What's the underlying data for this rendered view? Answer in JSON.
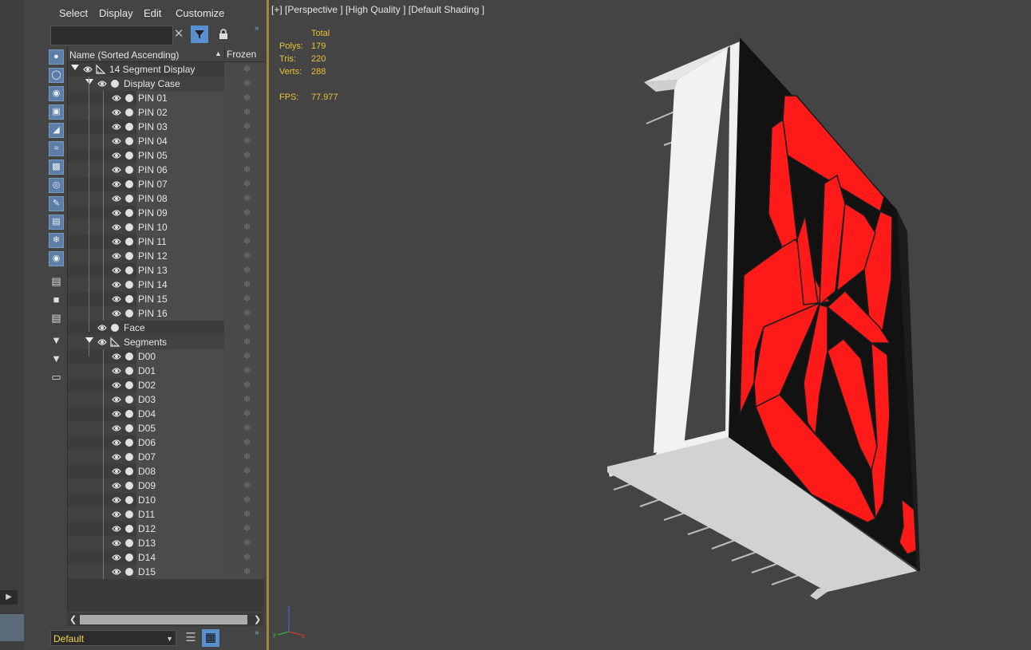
{
  "menu": {
    "select": "Select",
    "display": "Display",
    "edit": "Edit",
    "customize": "Customize"
  },
  "search": {
    "value": "",
    "placeholder": ""
  },
  "tree": {
    "col_name": "Name (Sorted Ascending)",
    "col_frozen": "Frozen",
    "rows": [
      {
        "label": "14 Segment Display",
        "depth": 0,
        "expander": true,
        "kind": "helper"
      },
      {
        "label": "Display Case",
        "depth": 1,
        "expander": true,
        "kind": "geo"
      },
      {
        "label": "PIN 01",
        "depth": 2,
        "expander": false,
        "kind": "geo"
      },
      {
        "label": "PIN 02",
        "depth": 2,
        "expander": false,
        "kind": "geo"
      },
      {
        "label": "PIN 03",
        "depth": 2,
        "expander": false,
        "kind": "geo"
      },
      {
        "label": "PIN 04",
        "depth": 2,
        "expander": false,
        "kind": "geo"
      },
      {
        "label": "PIN 05",
        "depth": 2,
        "expander": false,
        "kind": "geo"
      },
      {
        "label": "PIN 06",
        "depth": 2,
        "expander": false,
        "kind": "geo"
      },
      {
        "label": "PIN 07",
        "depth": 2,
        "expander": false,
        "kind": "geo"
      },
      {
        "label": "PIN 08",
        "depth": 2,
        "expander": false,
        "kind": "geo"
      },
      {
        "label": "PIN 09",
        "depth": 2,
        "expander": false,
        "kind": "geo"
      },
      {
        "label": "PIN 10",
        "depth": 2,
        "expander": false,
        "kind": "geo"
      },
      {
        "label": "PIN 11",
        "depth": 2,
        "expander": false,
        "kind": "geo"
      },
      {
        "label": "PIN 12",
        "depth": 2,
        "expander": false,
        "kind": "geo"
      },
      {
        "label": "PIN 13",
        "depth": 2,
        "expander": false,
        "kind": "geo"
      },
      {
        "label": "PIN 14",
        "depth": 2,
        "expander": false,
        "kind": "geo"
      },
      {
        "label": "PIN 15",
        "depth": 2,
        "expander": false,
        "kind": "geo"
      },
      {
        "label": "PIN 16",
        "depth": 2,
        "expander": false,
        "kind": "geo"
      },
      {
        "label": "Face",
        "depth": 1,
        "expander": false,
        "kind": "geo"
      },
      {
        "label": "Segments",
        "depth": 1,
        "expander": true,
        "kind": "helper"
      },
      {
        "label": "D00",
        "depth": 2,
        "expander": false,
        "kind": "geo"
      },
      {
        "label": "D01",
        "depth": 2,
        "expander": false,
        "kind": "geo"
      },
      {
        "label": "D02",
        "depth": 2,
        "expander": false,
        "kind": "geo"
      },
      {
        "label": "D03",
        "depth": 2,
        "expander": false,
        "kind": "geo"
      },
      {
        "label": "D04",
        "depth": 2,
        "expander": false,
        "kind": "geo"
      },
      {
        "label": "D05",
        "depth": 2,
        "expander": false,
        "kind": "geo"
      },
      {
        "label": "D06",
        "depth": 2,
        "expander": false,
        "kind": "geo"
      },
      {
        "label": "D07",
        "depth": 2,
        "expander": false,
        "kind": "geo"
      },
      {
        "label": "D08",
        "depth": 2,
        "expander": false,
        "kind": "geo"
      },
      {
        "label": "D09",
        "depth": 2,
        "expander": false,
        "kind": "geo"
      },
      {
        "label": "D10",
        "depth": 2,
        "expander": false,
        "kind": "geo"
      },
      {
        "label": "D11",
        "depth": 2,
        "expander": false,
        "kind": "geo"
      },
      {
        "label": "D12",
        "depth": 2,
        "expander": false,
        "kind": "geo"
      },
      {
        "label": "D13",
        "depth": 2,
        "expander": false,
        "kind": "geo"
      },
      {
        "label": "D14",
        "depth": 2,
        "expander": false,
        "kind": "geo"
      },
      {
        "label": "D15",
        "depth": 2,
        "expander": false,
        "kind": "geo"
      }
    ]
  },
  "layer": {
    "value": "Default"
  },
  "viewport": {
    "label": "[+] [Perspective ] [High Quality ] [Default Shading ]",
    "stats": {
      "header": "Total",
      "polys_label": "Polys:",
      "polys": "179",
      "tris_label": "Tris:",
      "tris": "220",
      "verts_label": "Verts:",
      "verts": "288",
      "fps_label": "FPS:",
      "fps": "77.977"
    },
    "axis": {
      "z": "z",
      "y": "y",
      "x": "x"
    }
  },
  "colors": {
    "accent": "#5a8fd0",
    "stats_yellow": "#e8c233",
    "segment_red": "#ff1a1a",
    "viewport_bg": "#444444"
  },
  "icons": {
    "filter": "filter-icon",
    "clear": "close-icon",
    "lock": "lock-icon",
    "visibility": "eye-icon",
    "object": "circle-icon",
    "helper": "dummy-helper-icon",
    "frozen": "snowflake-icon"
  }
}
